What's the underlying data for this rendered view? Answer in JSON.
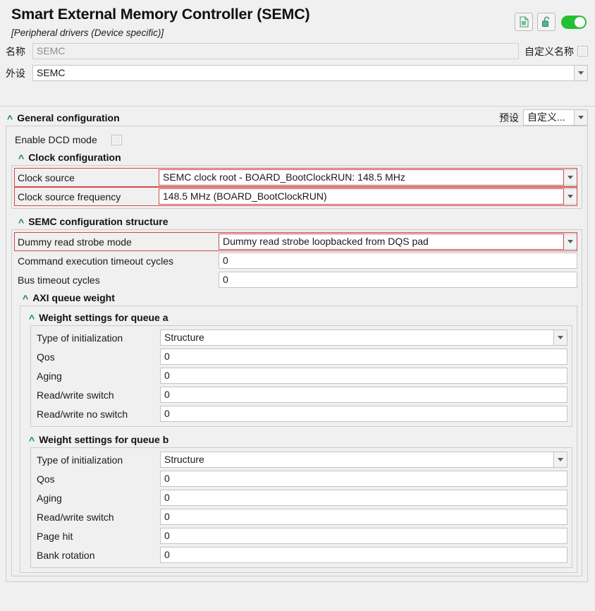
{
  "header": {
    "title": "Smart External Memory Controller (SEMC)",
    "subtitle": "[Peripheral drivers (Device specific)]",
    "icons": {
      "document": "document-icon",
      "unlock": "unlock-icon",
      "toggle_state": "on"
    }
  },
  "name_row": {
    "label": "名称",
    "value": "SEMC",
    "custom_label": "自定义名称",
    "custom_checked": false
  },
  "peripheral_row": {
    "label": "外设",
    "value": "SEMC"
  },
  "general": {
    "heading": "General configuration",
    "preset_label": "预设",
    "preset_value": "自定义...",
    "dcd": {
      "label": "Enable DCD mode",
      "checked": false
    },
    "clock_config": {
      "heading": "Clock configuration",
      "rows": [
        {
          "label": "Clock source",
          "value": "SEMC clock root - BOARD_BootClockRUN: 148.5 MHz",
          "type": "combo",
          "highlight": true
        },
        {
          "label": "Clock source frequency",
          "value": "148.5 MHz (BOARD_BootClockRUN)",
          "type": "combo",
          "highlight": true
        }
      ]
    },
    "semc_struct": {
      "heading": "SEMC configuration structure",
      "rows": [
        {
          "label": "Dummy read strobe mode",
          "value": "Dummy read strobe loopbacked from DQS pad",
          "type": "combo",
          "highlight": true
        },
        {
          "label": "Command execution timeout cycles",
          "value": "0",
          "type": "text",
          "highlight": false
        },
        {
          "label": "Bus timeout cycles",
          "value": "0",
          "type": "text",
          "highlight": false
        }
      ],
      "axi": {
        "heading": "AXI queue weight",
        "queue_a": {
          "heading": "Weight settings for queue a",
          "rows": [
            {
              "label": "Type of initialization",
              "value": "Structure",
              "type": "combo"
            },
            {
              "label": "Qos",
              "value": "0",
              "type": "text"
            },
            {
              "label": "Aging",
              "value": "0",
              "type": "text"
            },
            {
              "label": "Read/write switch",
              "value": "0",
              "type": "text"
            },
            {
              "label": "Read/write no switch",
              "value": "0",
              "type": "text"
            }
          ]
        },
        "queue_b": {
          "heading": "Weight settings for queue b",
          "rows": [
            {
              "label": "Type of initialization",
              "value": "Structure",
              "type": "combo"
            },
            {
              "label": "Qos",
              "value": "0",
              "type": "text"
            },
            {
              "label": "Aging",
              "value": "0",
              "type": "text"
            },
            {
              "label": "Read/write switch",
              "value": "0",
              "type": "text"
            },
            {
              "label": "Page hit",
              "value": "0",
              "type": "text"
            },
            {
              "label": "Bank rotation",
              "value": "0",
              "type": "text"
            }
          ]
        }
      }
    }
  },
  "colors": {
    "accent_teal": "#0e7f76",
    "toggle_green": "#22c032",
    "highlight_red": "#d04a4a",
    "background": "#f0f0f0"
  }
}
